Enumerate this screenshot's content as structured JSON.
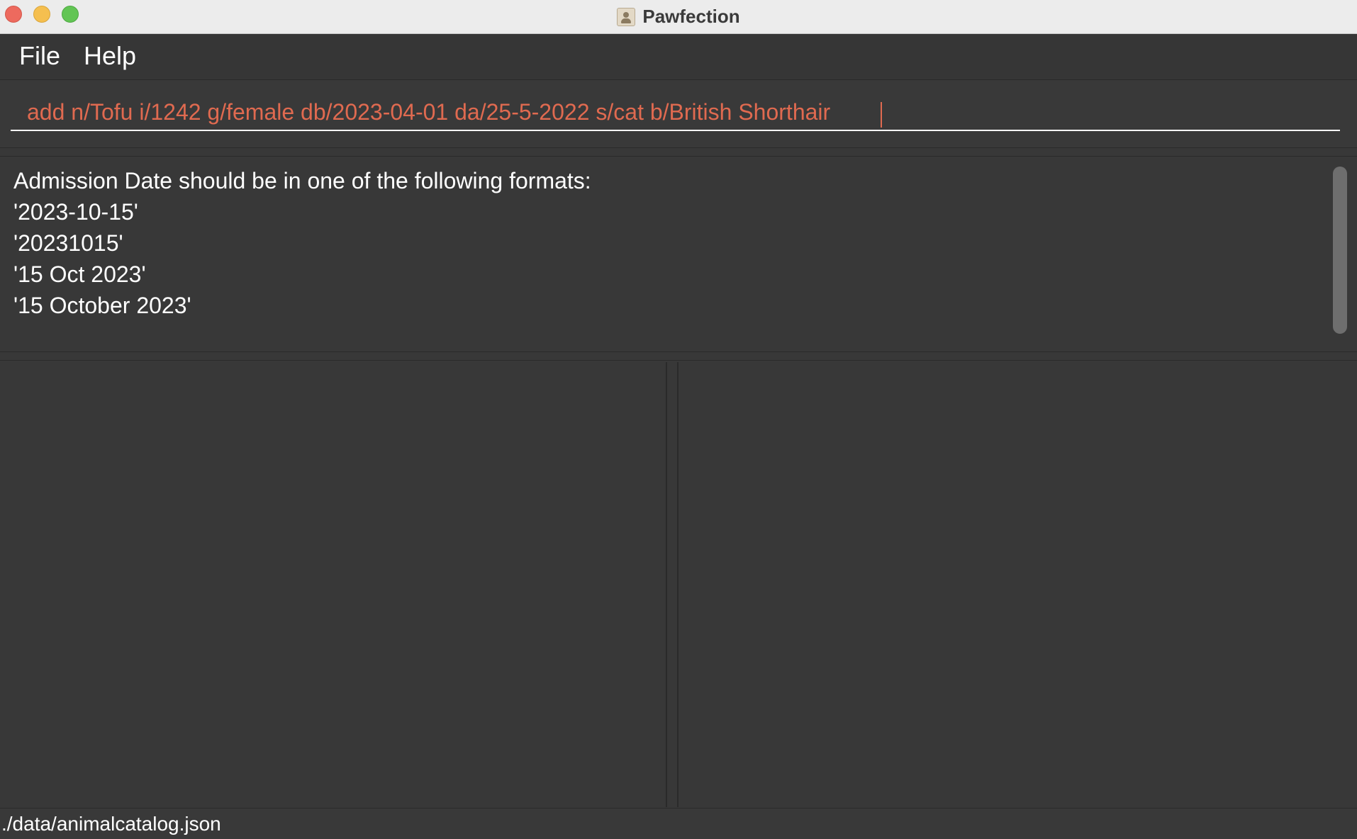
{
  "window": {
    "title": "Pawfection"
  },
  "menu": {
    "file_label": "File",
    "help_label": "Help"
  },
  "command": {
    "value": "add n/Tofu i/1242 g/female db/2023-04-01 da/25-5-2022 s/cat b/British Shorthair",
    "text_color": "#e06a50"
  },
  "result": {
    "lines": [
      "Admission Date should be in one of the following formats:",
      "'2023-10-15'",
      "'20231015'",
      "'15 Oct 2023'",
      "'15 October 2023'"
    ]
  },
  "status": {
    "file_path": "./data/animalcatalog.json"
  }
}
